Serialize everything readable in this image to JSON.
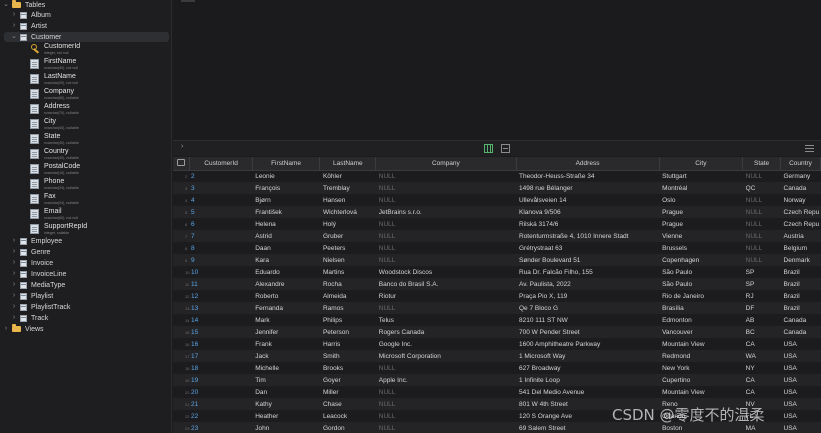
{
  "sidebar": {
    "tables_label": "Tables",
    "views_label": "Views",
    "tables_before": [
      "Album",
      "Artist"
    ],
    "selected_table": "Customer",
    "columns": [
      {
        "name": "CustomerId",
        "type": "integer, not null",
        "key": true
      },
      {
        "name": "FirstName",
        "type": "nvarchar(40), not null"
      },
      {
        "name": "LastName",
        "type": "nvarchar(20), not null"
      },
      {
        "name": "Company",
        "type": "nvarchar(80), nullable"
      },
      {
        "name": "Address",
        "type": "nvarchar(70), nullable"
      },
      {
        "name": "City",
        "type": "nvarchar(40), nullable"
      },
      {
        "name": "State",
        "type": "nvarchar(40), nullable"
      },
      {
        "name": "Country",
        "type": "nvarchar(40), nullable"
      },
      {
        "name": "PostalCode",
        "type": "nvarchar(10), nullable"
      },
      {
        "name": "Phone",
        "type": "nvarchar(24), nullable"
      },
      {
        "name": "Fax",
        "type": "nvarchar(24), nullable"
      },
      {
        "name": "Email",
        "type": "nvarchar(60), not null"
      },
      {
        "name": "SupportRepId",
        "type": "integer, nullable"
      }
    ],
    "tables_after": [
      "Employee",
      "Genre",
      "Invoice",
      "InvoiceLine",
      "MediaType",
      "Playlist",
      "PlaylistTrack",
      "Track"
    ]
  },
  "grid": {
    "headers": [
      "CustomerId",
      "FirstName",
      "LastName",
      "Company",
      "Address",
      "City",
      "State",
      "Country"
    ],
    "null_text": "NULL",
    "rows": [
      {
        "rn": "2",
        "id": "2",
        "first": "Leonie",
        "last": "Köhler",
        "company": null,
        "address": "Theodor-Heuss-Straße 34",
        "city": "Stuttgart",
        "state": null,
        "country": "Germany"
      },
      {
        "rn": "3",
        "id": "3",
        "first": "François",
        "last": "Tremblay",
        "company": null,
        "address": "1498 rue Bélanger",
        "city": "Montréal",
        "state": "QC",
        "country": "Canada"
      },
      {
        "rn": "4",
        "id": "4",
        "first": "Bjørn",
        "last": "Hansen",
        "company": null,
        "address": "Ullevålsveien 14",
        "city": "Oslo",
        "state": null,
        "country": "Norway"
      },
      {
        "rn": "5",
        "id": "5",
        "first": "František",
        "last": "Wichterlová",
        "company": "JetBrains s.r.o.",
        "address": "Klanova 9/506",
        "city": "Prague",
        "state": null,
        "country": "Czech Repu"
      },
      {
        "rn": "6",
        "id": "6",
        "first": "Helena",
        "last": "Holý",
        "company": null,
        "address": "Rilská 3174/6",
        "city": "Prague",
        "state": null,
        "country": "Czech Repu"
      },
      {
        "rn": "7",
        "id": "7",
        "first": "Astrid",
        "last": "Gruber",
        "company": null,
        "address": "Rotenturmstraße 4, 1010 Innere Stadt",
        "city": "Vienne",
        "state": null,
        "country": "Austria"
      },
      {
        "rn": "8",
        "id": "8",
        "first": "Daan",
        "last": "Peeters",
        "company": null,
        "address": "Grétrystraat 63",
        "city": "Brussels",
        "state": null,
        "country": "Belgium"
      },
      {
        "rn": "9",
        "id": "9",
        "first": "Kara",
        "last": "Nielsen",
        "company": null,
        "address": "Sønder Boulevard 51",
        "city": "Copenhagen",
        "state": null,
        "country": "Denmark"
      },
      {
        "rn": "10",
        "id": "10",
        "first": "Eduardo",
        "last": "Martins",
        "company": "Woodstock Discos",
        "address": "Rua Dr. Falcão Filho, 155",
        "city": "São Paulo",
        "state": "SP",
        "country": "Brazil"
      },
      {
        "rn": "11",
        "id": "11",
        "first": "Alexandre",
        "last": "Rocha",
        "company": "Banco do Brasil S.A.",
        "address": "Av. Paulista, 2022",
        "city": "São Paulo",
        "state": "SP",
        "country": "Brazil"
      },
      {
        "rn": "12",
        "id": "12",
        "first": "Roberto",
        "last": "Almeida",
        "company": "Riotur",
        "address": "Praça Pio X, 119",
        "city": "Rio de Janeiro",
        "state": "RJ",
        "country": "Brazil"
      },
      {
        "rn": "13",
        "id": "13",
        "first": "Fernanda",
        "last": "Ramos",
        "company": null,
        "address": "Qe 7 Bloco G",
        "city": "Brasília",
        "state": "DF",
        "country": "Brazil"
      },
      {
        "rn": "14",
        "id": "14",
        "first": "Mark",
        "last": "Philips",
        "company": "Telus",
        "address": "8210 111 ST NW",
        "city": "Edmonton",
        "state": "AB",
        "country": "Canada"
      },
      {
        "rn": "15",
        "id": "15",
        "first": "Jennifer",
        "last": "Peterson",
        "company": "Rogers Canada",
        "address": "700 W Pender Street",
        "city": "Vancouver",
        "state": "BC",
        "country": "Canada"
      },
      {
        "rn": "16",
        "id": "16",
        "first": "Frank",
        "last": "Harris",
        "company": "Google Inc.",
        "address": "1600 Amphitheatre Parkway",
        "city": "Mountain View",
        "state": "CA",
        "country": "USA"
      },
      {
        "rn": "17",
        "id": "17",
        "first": "Jack",
        "last": "Smith",
        "company": "Microsoft Corporation",
        "address": "1 Microsoft Way",
        "city": "Redmond",
        "state": "WA",
        "country": "USA"
      },
      {
        "rn": "18",
        "id": "18",
        "first": "Michelle",
        "last": "Brooks",
        "company": null,
        "address": "627 Broadway",
        "city": "New York",
        "state": "NY",
        "country": "USA"
      },
      {
        "rn": "19",
        "id": "19",
        "first": "Tim",
        "last": "Goyer",
        "company": "Apple Inc.",
        "address": "1 Infinite Loop",
        "city": "Cupertino",
        "state": "CA",
        "country": "USA"
      },
      {
        "rn": "20",
        "id": "20",
        "first": "Dan",
        "last": "Miller",
        "company": null,
        "address": "541 Del Medio Avenue",
        "city": "Mountain View",
        "state": "CA",
        "country": "USA"
      },
      {
        "rn": "21",
        "id": "21",
        "first": "Kathy",
        "last": "Chase",
        "company": null,
        "address": "801 W 4th Street",
        "city": "Reno",
        "state": "NV",
        "country": "USA"
      },
      {
        "rn": "22",
        "id": "22",
        "first": "Heather",
        "last": "Leacock",
        "company": null,
        "address": "120 S Orange Ave",
        "city": "Orlando",
        "state": "FL",
        "country": "USA"
      },
      {
        "rn": "23",
        "id": "23",
        "first": "John",
        "last": "Gordon",
        "company": null,
        "address": "69 Salem Street",
        "city": "Boston",
        "state": "MA",
        "country": "USA"
      }
    ]
  },
  "watermark": "CSDN @零度不的温柔"
}
